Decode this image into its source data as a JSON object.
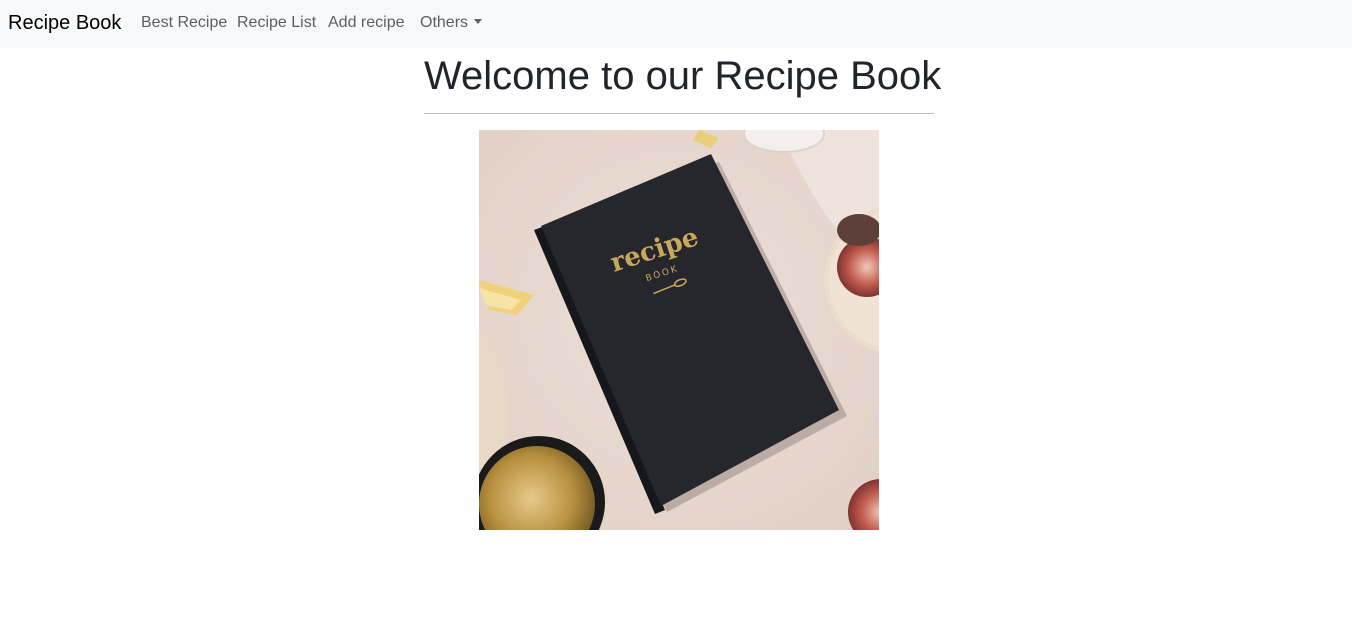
{
  "navbar": {
    "brand": "Recipe Book",
    "links": [
      {
        "label": "Best Recipe"
      },
      {
        "label": "Recipe List"
      },
      {
        "label": "Add recipe"
      },
      {
        "label": "Others"
      }
    ]
  },
  "main": {
    "title": "Welcome to our Recipe Book",
    "image": {
      "subject": "recipe-book-photo",
      "cover_text": "recipe",
      "cover_subtext": "BOOK"
    }
  },
  "colors": {
    "navbar_bg": "#f8f9fa",
    "link": "#5c5f62",
    "book": "#24262b",
    "gold": "#c9a75b"
  }
}
